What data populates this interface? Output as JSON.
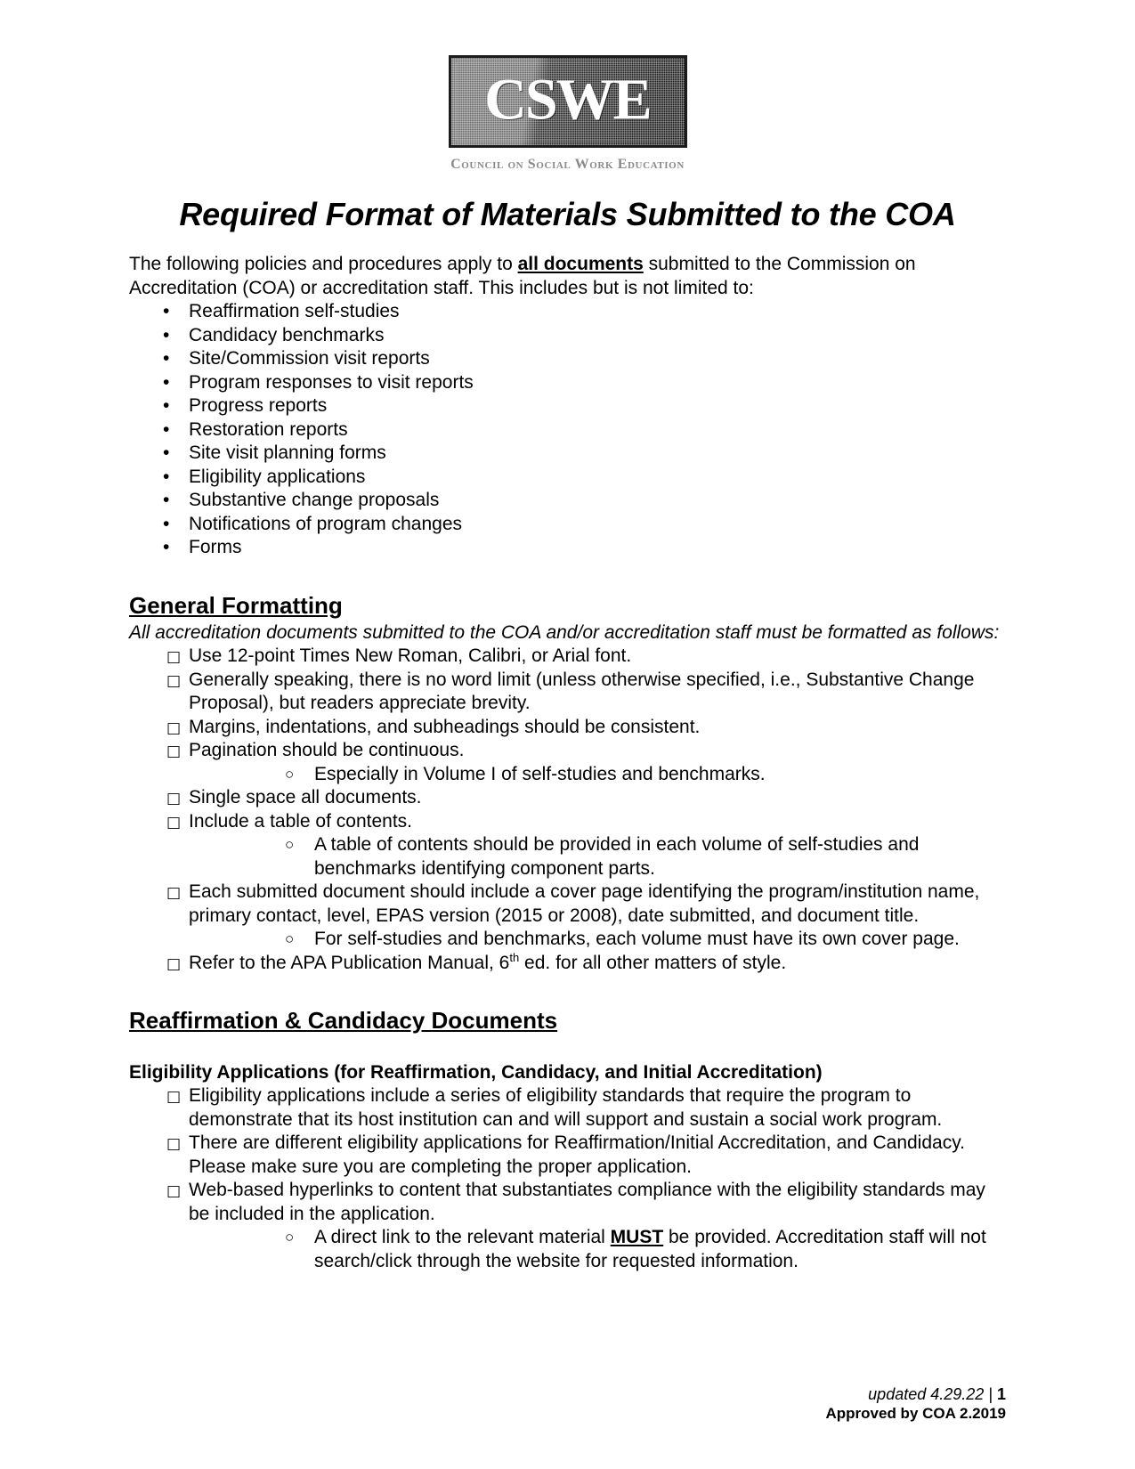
{
  "logo": {
    "mark_text": "CSWE",
    "subtitle": "Council on Social Work Education",
    "alt": "cswe-logo"
  },
  "title": "Required Format of Materials Submitted to the COA",
  "intro": {
    "before_emphasis": "The following policies and procedures apply to ",
    "emphasis": "all documents",
    "after_emphasis": " submitted to the Commission on Accreditation (COA) or accreditation staff. This includes but is not limited to:"
  },
  "intro_list": [
    "Reaffirmation self-studies",
    "Candidacy benchmarks",
    "Site/Commission visit reports",
    "Program responses to visit reports",
    "Progress reports",
    "Restoration reports",
    "Site visit planning forms",
    "Eligibility applications",
    "Substantive change proposals",
    "Notifications of program changes",
    "Forms"
  ],
  "general_formatting": {
    "heading": "General Formatting",
    "lead_in": "All accreditation documents submitted to the COA and/or accreditation staff must be formatted as follows:",
    "items": [
      {
        "text": "Use 12-point Times New Roman, Calibri, or Arial font."
      },
      {
        "text": "Generally speaking, there is no word limit (unless otherwise specified, i.e., Substantive Change Proposal), but readers appreciate brevity."
      },
      {
        "text": "Margins, indentations, and subheadings should be consistent."
      },
      {
        "text": "Pagination should be continuous.",
        "subitems": [
          "Especially in Volume I of self-studies and benchmarks."
        ]
      },
      {
        "text": "Single space all documents."
      },
      {
        "text": "Include a table of contents.",
        "subitems": [
          "A table of contents should be provided in each volume of self-studies and benchmarks identifying component parts."
        ]
      },
      {
        "text": "Each submitted document should include a cover page identifying the program/institution name, primary contact, level, EPAS version (2015 or 2008), date submitted, and document title.",
        "subitems": [
          "For self-studies and benchmarks, each volume must have its own cover page."
        ]
      },
      {
        "text_before_sup": "Refer to the APA Publication Manual, 6",
        "sup": "th",
        "text_after_sup": " ed. for all other matters of style."
      }
    ]
  },
  "reaffirmation": {
    "heading": "Reaffirmation & Candidacy Documents",
    "subheading": "Eligibility Applications (for Reaffirmation, Candidacy, and Initial Accreditation)",
    "items": [
      {
        "text": "Eligibility applications include a series of eligibility standards that require the program to demonstrate that its host institution can and will support and sustain a social work program."
      },
      {
        "text": "There are different eligibility applications for Reaffirmation/Initial Accreditation, and Candidacy. Please make sure you are completing the proper application."
      },
      {
        "text": "Web-based hyperlinks to content that substantiates compliance with the eligibility standards may be included in the application.",
        "subitem_parts": {
          "before": "A direct link to the relevant material ",
          "emphasis": "MUST",
          "after": " be provided. Accreditation staff will not search/click through the website for requested information."
        }
      }
    ]
  },
  "footer": {
    "updated_label": "updated 4.29.22 | ",
    "page_number": "1",
    "approved": "Approved by COA 2.2019"
  },
  "markers": {
    "disc": "•",
    "square": "□",
    "circle": "○"
  }
}
